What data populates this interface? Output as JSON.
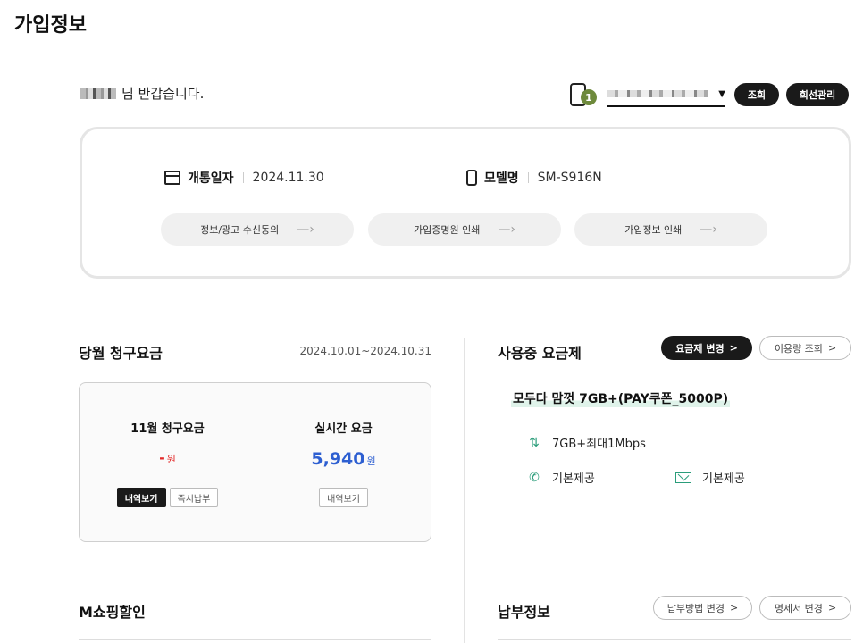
{
  "page": {
    "title": "가입정보"
  },
  "greeting": {
    "suffix": "님 반갑습니다."
  },
  "line_selector": {
    "count": "1",
    "lookup_label": "조회",
    "line_mgmt_label": "회선관리"
  },
  "subscription": {
    "open_date_label": "개통일자",
    "open_date": "2024.11.30",
    "model_label": "모델명",
    "model": "SM-S916N",
    "actions": [
      {
        "label": "정보/광고 수신동의",
        "arrow": "—›"
      },
      {
        "label": "가입증명원 인쇄",
        "arrow": "—›"
      },
      {
        "label": "가입정보 인쇄",
        "arrow": "—›"
      }
    ]
  },
  "bill": {
    "title": "당월 청구요금",
    "period": "2024.10.01~2024.10.31",
    "monthly": {
      "title": "11월 청구요금",
      "amount": "-",
      "unit": "원",
      "detail_label": "내역보기",
      "pay_label": "즉시납부"
    },
    "realtime": {
      "title": "실시간 요금",
      "amount": "5,940",
      "unit": "원",
      "detail_label": "내역보기"
    }
  },
  "plan": {
    "title": "사용중 요금제",
    "change_label": "요금제 변경",
    "usage_label": "이용량 조회",
    "name": "모두다 맘껏 7GB+(PAY쿠폰_5000P)",
    "data": "7GB+최대1Mbps",
    "voice": "기본제공",
    "sms": "기본제공"
  },
  "mshopping": {
    "title": "M쇼핑할인"
  },
  "payment": {
    "title": "납부정보",
    "method_change_label": "납부방법 변경",
    "statement_change_label": "명세서 변경"
  },
  "colors": {
    "accent_green": "#2a9d7a",
    "badge_olive": "#6e8a3c",
    "red": "#e32a2a",
    "blue": "#2d5fd1"
  },
  "icons": [
    "calendar-icon",
    "mobile-icon",
    "phone-call-icon",
    "mail-icon",
    "up-down-arrows-icon",
    "chevron-right-icon"
  ]
}
